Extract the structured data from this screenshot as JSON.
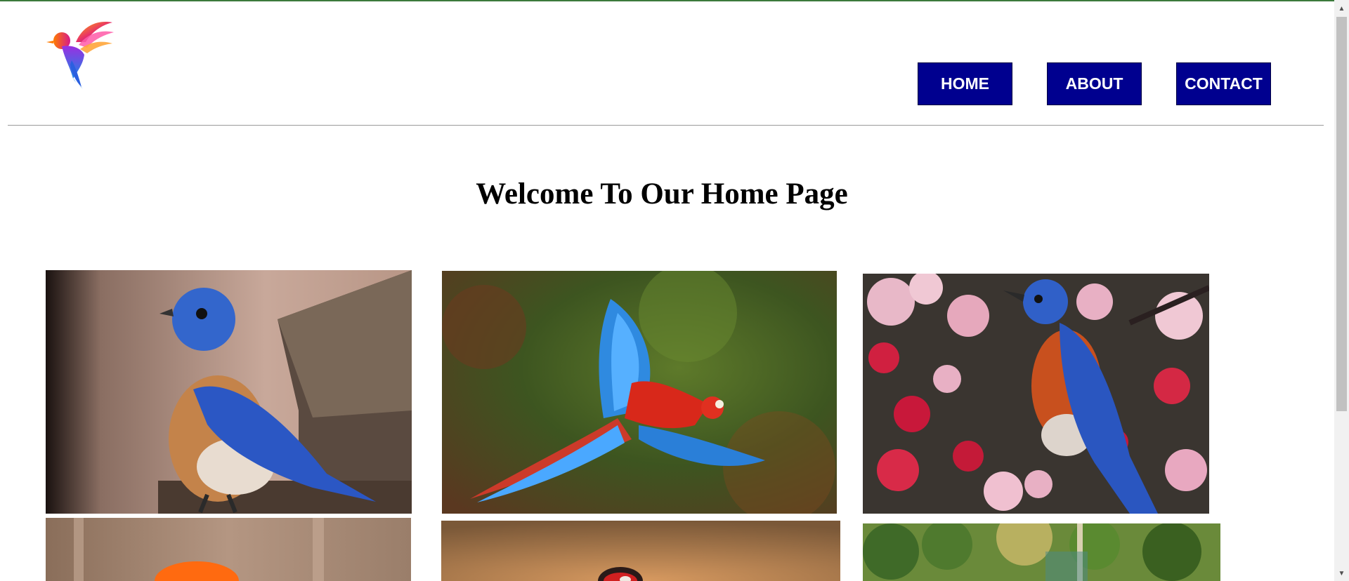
{
  "header": {
    "logo_icon": "bird-logo-icon",
    "nav": [
      {
        "label": "HOME"
      },
      {
        "label": "ABOUT"
      },
      {
        "label": "CONTACT"
      }
    ],
    "nav_color": "#00008f"
  },
  "main": {
    "title": "Welcome To Our Home Page",
    "gallery": [
      {
        "icon": "bluebird-on-birdhouse-image"
      },
      {
        "icon": "flying-macaw-image"
      },
      {
        "icon": "bluebird-in-blossoms-image"
      },
      {
        "icon": "orange-bird-image"
      },
      {
        "icon": "goldfinch-image"
      },
      {
        "icon": "forest-garden-image"
      }
    ]
  },
  "scrollbar": {
    "up_icon": "scroll-up-arrow-icon",
    "down_icon": "scroll-down-arrow-icon"
  }
}
